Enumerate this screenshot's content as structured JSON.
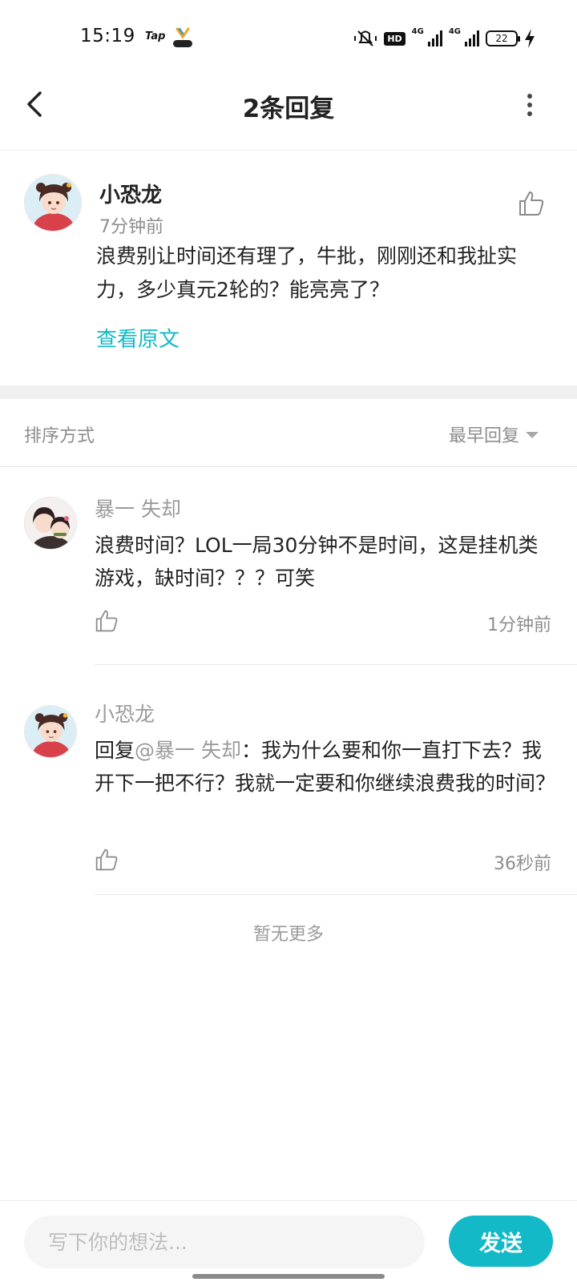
{
  "status_bar": {
    "time": "15:19",
    "app_label": "Tap",
    "hd_badge": "HD",
    "network_1": "4G",
    "network_2": "4G",
    "battery": "22"
  },
  "header": {
    "title": "2条回复",
    "icons": {
      "back": "chevron-left-icon",
      "more": "more-vertical-icon"
    }
  },
  "main_comment": {
    "author": "小恐龙",
    "time": "7分钟前",
    "text": "浪费别让时间还有理了，牛批，刚刚还和我扯实力，多少真元2轮的？能亮亮了？",
    "view_original": "查看原文"
  },
  "sort": {
    "label": "排序方式",
    "value": "最早回复"
  },
  "replies": [
    {
      "author": "暴一 失却",
      "text": "浪费时间？LOL一局30分钟不是时间，这是挂机类游戏，缺时间？？？可笑",
      "time": "1分钟前"
    },
    {
      "author": "小恐龙",
      "reply_prefix": "回复",
      "mention": "@暴一 失却",
      "text": "：我为什么要和你一直打下去？我开下一把不行？我就一定要和你继续浪费我的时间？",
      "time": "36秒前"
    }
  ],
  "no_more": "暂无更多",
  "composer": {
    "placeholder": "写下你的想法...",
    "send_label": "发送"
  },
  "colors": {
    "accent": "#14b9c8",
    "text": "#222222",
    "muted": "#8d8d8d",
    "divider_band": "#f0f0f0"
  }
}
